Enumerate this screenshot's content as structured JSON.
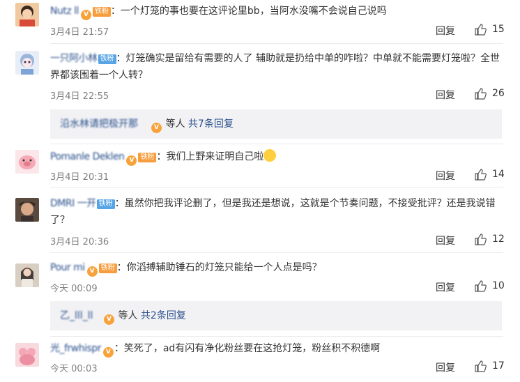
{
  "comments": [
    {
      "username": "Nutz  ll",
      "badge": "",
      "text": "：一个灯笼的事也要在这评论里bb，当阿水没嘴不会说自己说吗",
      "time": "3月4日 21:57",
      "reply_label": "回复",
      "likes": "15"
    },
    {
      "username": "一只阿小林",
      "badge": "铁粉",
      "text": "：灯笼确实是留给有需要的人了 辅助就是扔给中单的咋啦？中单就不能需要灯笼啦？全世界都该围着一个人转？",
      "time": "3月4日 22:55",
      "reply_label": "回复",
      "likes": "26",
      "sub_replies": {
        "names": "沿水林请把极开那",
        "suffix": " 等人 ",
        "more": "共7条回复"
      }
    },
    {
      "username": "Pomanle Deklen",
      "badge": "铁粉",
      "text": "：我们上野来证明自己啦",
      "time": "3月4日 20:31",
      "reply_label": "回复",
      "likes": "14"
    },
    {
      "username": "DMRI 一开",
      "badge": "铁粉",
      "text": "：虽然你把我评论删了，但是我还是想说，这就是个节奏问题，不接受批评？还是我说错了？",
      "time": "3月4日 20:36",
      "reply_label": "回复",
      "likes": "12"
    },
    {
      "username": "Pour mi",
      "badge": "铁粉",
      "text": "：你滔搏辅助锤石的灯笼只能给一个人点是吗？",
      "time": "今天 00:09",
      "reply_label": "回复",
      "likes": "10",
      "sub_replies": {
        "names": "乙_lll_ll",
        "suffix": " 等人 ",
        "more": "共2条回复"
      }
    },
    {
      "username": "光_frwhispr",
      "badge": "",
      "text": "：笑死了，ad有闪有净化粉丝要在这抢灯笼，粉丝积不积德啊",
      "time": "今天 00:03",
      "reply_label": "回复",
      "likes": "17"
    }
  ]
}
